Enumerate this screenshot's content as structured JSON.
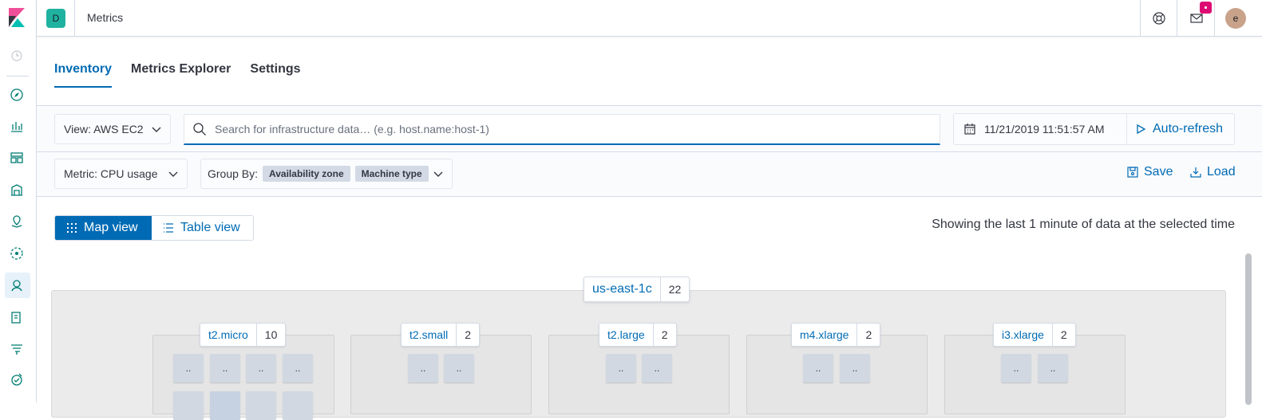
{
  "app": {
    "title": "Metrics",
    "space_initial": "D",
    "user_initial": "e"
  },
  "tabs": [
    {
      "label": "Inventory",
      "active": true
    },
    {
      "label": "Metrics Explorer",
      "active": false
    },
    {
      "label": "Settings",
      "active": false
    }
  ],
  "toolbar": {
    "view_label": "View: AWS EC2",
    "search_placeholder": "Search for infrastructure data… (e.g. host.name:host-1)",
    "date": "11/21/2019 11:51:57 AM",
    "auto_refresh_label": "Auto-refresh",
    "metric_label": "Metric: CPU usage",
    "group_by_label": "Group By:",
    "group_by_badges": [
      "Availability zone",
      "Machine type"
    ],
    "save_label": "Save",
    "load_label": "Load"
  },
  "view_toggle": {
    "map_label": "Map view",
    "table_label": "Table view",
    "selected": "map"
  },
  "showing_text": "Showing the last 1 minute of data at the selected time",
  "zone": {
    "name": "us-east-1c",
    "count": "22"
  },
  "groups": [
    {
      "name": "t2.micro",
      "count": "10"
    },
    {
      "name": "t2.small",
      "count": "2"
    },
    {
      "name": "t2.large",
      "count": "2"
    },
    {
      "name": "m4.xlarge",
      "count": "2"
    },
    {
      "name": "i3.xlarge",
      "count": "2"
    }
  ],
  "node_label": "..",
  "icons": {
    "rail": [
      "kibana-logo",
      "clock-icon",
      "compass-icon",
      "chart-icon",
      "dashboard-icon",
      "canvas-icon",
      "maps-icon",
      "ml-icon",
      "infrastructure-icon",
      "logs-icon",
      "apm-icon",
      "uptime-icon"
    ],
    "topbar": [
      "help-icon",
      "mail-icon"
    ]
  },
  "colors": {
    "accent": "#006bb4",
    "notification": "#dd0a73",
    "space_avatar": "#20b2a0"
  }
}
